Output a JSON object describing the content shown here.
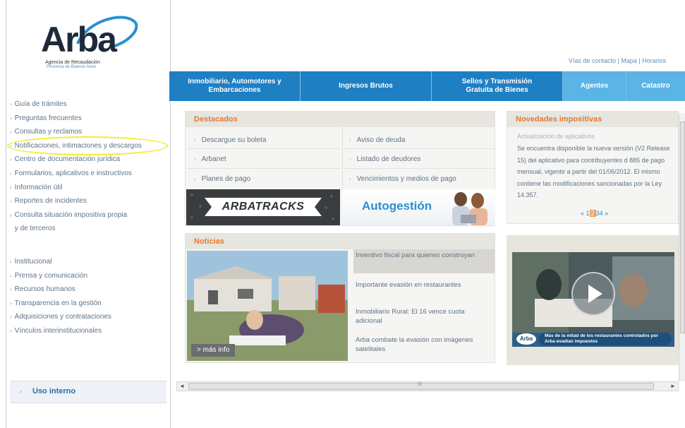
{
  "logo": {
    "name": "Arba",
    "line1": "Agencia de Recaudación",
    "line2": "Provincia de Buenos Aires"
  },
  "top_links": "Vías de contacto | Mapa | Horarios",
  "nav": {
    "tabs": [
      {
        "label": "Inmobiliario, Automotores y Embarcaciones"
      },
      {
        "label": "Ingresos Brutos"
      },
      {
        "label": "Sellos y Transmisión Gratuita de Bienes"
      },
      {
        "label": "Agentes"
      },
      {
        "label": "Catastro"
      }
    ]
  },
  "sidebar": {
    "menu1": [
      "Guía de trámites",
      "Preguntas frecuentes",
      "Consultas y reclamos",
      "Notificaciones, intimaciones y descargos",
      "Centro de documentación jurídica",
      "Formularios, aplicativos e instructivos",
      "Información útil",
      "Reportes de incidentes",
      "Consulta situación impositiva propia",
      "y de terceros"
    ],
    "menu2": [
      "Institucional",
      "Prensa y comunicación",
      "Recursos humanos",
      "Transparencia en la gestión",
      "Adquisiciones y contrataciones",
      "Vínculos interinstitucionales"
    ],
    "uso_interno": "Uso interno"
  },
  "destacados": {
    "title": "Destacados",
    "left_items": [
      "Descargue su boleta",
      "Arbanet",
      "Planes de pago"
    ],
    "right_items": [
      "Aviso de deuda",
      "Listado de deudores",
      "Vencimientos y medios de pago"
    ],
    "banner_tracks": "ARBATRACKS",
    "banner_auto": "Autogestión"
  },
  "novedades": {
    "title": "Novedades impositivas",
    "item_title": "Actualización de aplicativos",
    "item_body": "Se encuentra disponible la nueva versión (V2 Release 15) del aplicativo para contribuyentes d 885 de pago mensual, vigente a partir del 01/06/2012. El mismo contiene las modificaciones sancionadas por la Ley 14.357.",
    "pages": [
      "1",
      "2",
      "3",
      "4"
    ],
    "prev": "«",
    "next": "»"
  },
  "noticias": {
    "title": "Noticias",
    "more": "> más info",
    "items": [
      "Inventivo fiscal para quienes construyan",
      "Importante evasión en restaurantes",
      "Inmobiliario Rural: El 16 vence cuota adicional",
      "Arba combate la evasión con imágenes satelitales"
    ]
  },
  "video": {
    "badge": "Arba",
    "caption": "Más de la mitad de los restaurantes controlados por Arba evadían impuestos"
  },
  "scrollbar": {
    "center_mark": "III"
  },
  "colors": {
    "nav_blue": "#2a8fd0",
    "accent_orange": "#e47a2f",
    "highlight_yellow": "#f0ee2a"
  }
}
